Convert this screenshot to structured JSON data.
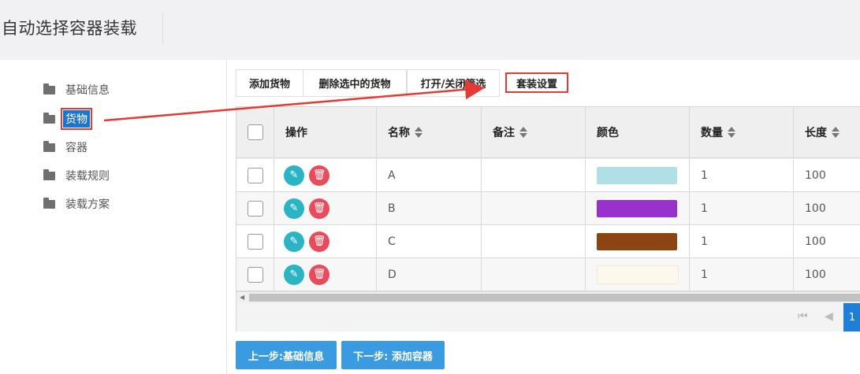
{
  "header": {
    "title": "自动选择容器装载"
  },
  "sidebar": {
    "items": [
      {
        "label": "基础信息"
      },
      {
        "label": "货物"
      },
      {
        "label": "容器"
      },
      {
        "label": "装载规则"
      },
      {
        "label": "装载方案"
      }
    ],
    "active_index": 1
  },
  "toolbar": {
    "add": "添加货物",
    "delete_selected": "删除选中的货物",
    "toggle_filter": "打开/关闭筛选",
    "set_settings": "套装设置"
  },
  "table": {
    "columns": [
      "操作",
      "名称",
      "备注",
      "颜色",
      "数量",
      "长度"
    ],
    "rows": [
      {
        "name": "A",
        "note": "",
        "color": "#b0e0e6",
        "quantity": "1",
        "length": "100"
      },
      {
        "name": "B",
        "note": "",
        "color": "#9932cc",
        "quantity": "1",
        "length": "100"
      },
      {
        "name": "C",
        "note": "",
        "color": "#8b4513",
        "quantity": "1",
        "length": "100"
      },
      {
        "name": "D",
        "note": "",
        "color": "#fdf8ec",
        "quantity": "1",
        "length": "100"
      }
    ]
  },
  "pager": {
    "current_page": "1"
  },
  "footer": {
    "prev": "上一步:基础信息",
    "next": "下一步: 添加容器"
  },
  "colors": {
    "accent": "#1e74c8",
    "highlight": "#e53935",
    "button": "#3a9be0"
  }
}
